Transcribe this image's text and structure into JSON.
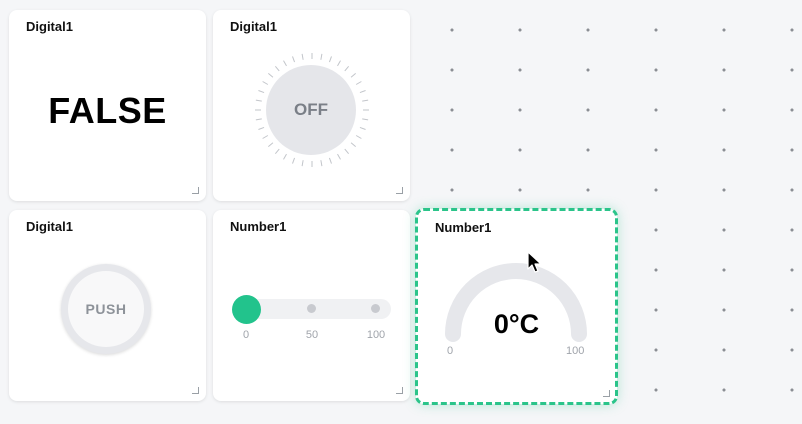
{
  "widgets": {
    "digital_text": {
      "title": "Digital1",
      "value": "FALSE"
    },
    "digital_knob": {
      "title": "Digital1",
      "state": "OFF"
    },
    "digital_push": {
      "title": "Digital1",
      "label": "PUSH"
    },
    "number_slider": {
      "title": "Number1",
      "value": 0,
      "min_label": "0",
      "mid_label": "50",
      "max_label": "100"
    },
    "number_gauge": {
      "title": "Number1",
      "value": "0°C",
      "min_label": "0",
      "max_label": "100"
    }
  },
  "colors": {
    "accent": "#22c38c",
    "selection_border": "#2bc48a"
  }
}
